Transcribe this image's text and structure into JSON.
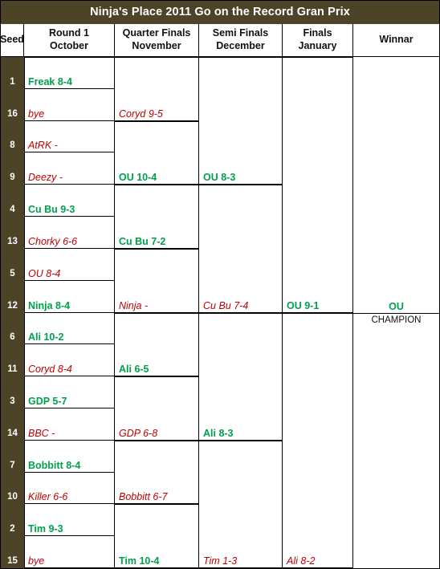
{
  "title": "Ninja's Place 2011 Go on the Record Gran Prix",
  "headers": [
    {
      "line1": "Seed",
      "line2": ""
    },
    {
      "line1": "Round 1",
      "line2": "October"
    },
    {
      "line1": "Quarter Finals",
      "line2": "November"
    },
    {
      "line1": "Semi Finals",
      "line2": "December"
    },
    {
      "line1": "Finals",
      "line2": "January"
    },
    {
      "line1": "Winnar",
      "line2": ""
    }
  ],
  "colors": {
    "header_bg": "#4d4427",
    "seed_bg": "#4d4427",
    "winner_text": "#00a14b",
    "loser_text": "#c00000",
    "line": "#000000"
  },
  "seeds": [
    "1",
    "16",
    "8",
    "9",
    "4",
    "13",
    "5",
    "12",
    "6",
    "11",
    "3",
    "14",
    "7",
    "10",
    "2",
    "15"
  ],
  "round1": [
    {
      "label": "Freak 8-4",
      "result": "win"
    },
    {
      "label": "bye",
      "result": "lose"
    },
    {
      "label": "AtRK -",
      "result": "lose"
    },
    {
      "label": "Deezy  -",
      "result": "lose"
    },
    {
      "label": "Cu Bu 9-3",
      "result": "win"
    },
    {
      "label": "Chorky 6-6",
      "result": "lose"
    },
    {
      "label": "OU 8-4",
      "result": "lose"
    },
    {
      "label": "Ninja 8-4",
      "result": "win"
    },
    {
      "label": "Ali 10-2",
      "result": "win"
    },
    {
      "label": "Coryd 8-4",
      "result": "lose"
    },
    {
      "label": "GDP 5-7",
      "result": "win"
    },
    {
      "label": "BBC -",
      "result": "lose"
    },
    {
      "label": "Bobbitt 8-4",
      "result": "win"
    },
    {
      "label": "Killer 6-6",
      "result": "lose"
    },
    {
      "label": "Tim 9-3",
      "result": "win"
    },
    {
      "label": "bye",
      "result": "lose"
    }
  ],
  "quarter_finals": [
    {
      "label": "Coryd 9-5",
      "result": "lose"
    },
    {
      "label": "OU 10-4",
      "result": "win"
    },
    {
      "label": "Cu Bu 7-2",
      "result": "win"
    },
    {
      "label": "Ninja -",
      "result": "lose"
    },
    {
      "label": "Ali 6-5",
      "result": "win"
    },
    {
      "label": "GDP 6-8",
      "result": "lose"
    },
    {
      "label": "Bobbitt 6-7",
      "result": "lose"
    },
    {
      "label": "Tim 10-4",
      "result": "win"
    }
  ],
  "semi_finals": [
    {
      "label": "OU 8-3",
      "result": "win"
    },
    {
      "label": "Cu Bu 7-4",
      "result": "lose"
    },
    {
      "label": "Ali 8-3",
      "result": "win"
    },
    {
      "label": "Tim 1-3",
      "result": "lose"
    }
  ],
  "finals": [
    {
      "label": "OU 9-1",
      "result": "win"
    },
    {
      "label": "Ali 8-2",
      "result": "lose"
    }
  ],
  "champion": {
    "name": "OU",
    "subtitle": "CHAMPION"
  },
  "chart_data": {
    "type": "table",
    "title": "Ninja's Place 2011 Go on the Record Gran Prix",
    "rounds": [
      "Round 1 October",
      "Quarter Finals November",
      "Semi Finals December",
      "Finals January",
      "Winnar"
    ],
    "bracket": [
      {
        "round": "Round 1",
        "seed": "1",
        "entry": "Freak 8-4",
        "advanced": true
      },
      {
        "round": "Round 1",
        "seed": "16",
        "entry": "bye",
        "advanced": false
      },
      {
        "round": "Round 1",
        "seed": "8",
        "entry": "AtRK -",
        "advanced": false
      },
      {
        "round": "Round 1",
        "seed": "9",
        "entry": "Deezy  -",
        "advanced": false
      },
      {
        "round": "Round 1",
        "seed": "4",
        "entry": "Cu Bu 9-3",
        "advanced": true
      },
      {
        "round": "Round 1",
        "seed": "13",
        "entry": "Chorky 6-6",
        "advanced": false
      },
      {
        "round": "Round 1",
        "seed": "5",
        "entry": "OU 8-4",
        "advanced": false
      },
      {
        "round": "Round 1",
        "seed": "12",
        "entry": "Ninja 8-4",
        "advanced": true
      },
      {
        "round": "Round 1",
        "seed": "6",
        "entry": "Ali 10-2",
        "advanced": true
      },
      {
        "round": "Round 1",
        "seed": "11",
        "entry": "Coryd 8-4",
        "advanced": false
      },
      {
        "round": "Round 1",
        "seed": "3",
        "entry": "GDP 5-7",
        "advanced": true
      },
      {
        "round": "Round 1",
        "seed": "14",
        "entry": "BBC -",
        "advanced": false
      },
      {
        "round": "Round 1",
        "seed": "7",
        "entry": "Bobbitt 8-4",
        "advanced": true
      },
      {
        "round": "Round 1",
        "seed": "10",
        "entry": "Killer 6-6",
        "advanced": false
      },
      {
        "round": "Round 1",
        "seed": "2",
        "entry": "Tim 9-3",
        "advanced": true
      },
      {
        "round": "Round 1",
        "seed": "15",
        "entry": "bye",
        "advanced": false
      },
      {
        "round": "Quarter Finals",
        "entry": "Coryd 9-5",
        "advanced": false
      },
      {
        "round": "Quarter Finals",
        "entry": "OU 10-4",
        "advanced": true
      },
      {
        "round": "Quarter Finals",
        "entry": "Cu Bu 7-2",
        "advanced": true
      },
      {
        "round": "Quarter Finals",
        "entry": "Ninja -",
        "advanced": false
      },
      {
        "round": "Quarter Finals",
        "entry": "Ali 6-5",
        "advanced": true
      },
      {
        "round": "Quarter Finals",
        "entry": "GDP 6-8",
        "advanced": false
      },
      {
        "round": "Quarter Finals",
        "entry": "Bobbitt 6-7",
        "advanced": false
      },
      {
        "round": "Quarter Finals",
        "entry": "Tim 10-4",
        "advanced": true
      },
      {
        "round": "Semi Finals",
        "entry": "OU 8-3",
        "advanced": true
      },
      {
        "round": "Semi Finals",
        "entry": "Cu Bu 7-4",
        "advanced": false
      },
      {
        "round": "Semi Finals",
        "entry": "Ali 8-3",
        "advanced": true
      },
      {
        "round": "Semi Finals",
        "entry": "Tim 1-3",
        "advanced": false
      },
      {
        "round": "Finals",
        "entry": "OU 9-1",
        "advanced": true
      },
      {
        "round": "Finals",
        "entry": "Ali 8-2",
        "advanced": false
      },
      {
        "round": "Winnar",
        "entry": "OU",
        "advanced": true
      }
    ]
  }
}
